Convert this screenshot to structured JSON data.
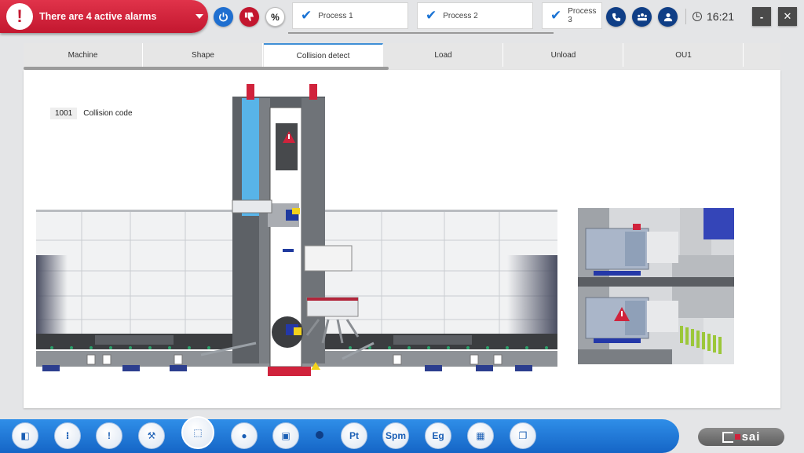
{
  "alarm": {
    "text": "There are 4 active alarms",
    "icon": "exclamation-icon",
    "color": "#d0233c"
  },
  "toolbar": {
    "power_icon": "power-icon",
    "thumb_icon": "thumbs-down-icon",
    "percent_label": "%",
    "phone_icon": "phone-icon",
    "people_icon": "team-icon",
    "user_icon": "user-icon"
  },
  "processes": [
    {
      "label": "Process 1",
      "checked": true
    },
    {
      "label": "Process 2",
      "checked": true
    },
    {
      "label": "Process 3",
      "checked": true
    }
  ],
  "clock": {
    "time": "16:21"
  },
  "window": {
    "minimize_label": "-",
    "close_label": "✕"
  },
  "tabs": [
    {
      "label": "Machine",
      "active": false
    },
    {
      "label": "Shape",
      "active": false
    },
    {
      "label": "Collision detect",
      "active": true
    },
    {
      "label": "Load",
      "active": false
    },
    {
      "label": "Unload",
      "active": false
    },
    {
      "label": "OU1",
      "active": false
    }
  ],
  "collision": {
    "code": "1001",
    "label": "Collision code"
  },
  "dock": {
    "items": [
      {
        "name": "home-dock-button",
        "icon": "split-arrow-icon",
        "glyph": "◧"
      },
      {
        "name": "modes-dock-button",
        "icon": "modes-icon",
        "glyph": "⁝"
      },
      {
        "name": "alarm-dock-button",
        "icon": "exclamation-icon",
        "glyph": "!"
      },
      {
        "name": "tools-dock-button",
        "icon": "wrench-icon",
        "glyph": "⚒"
      },
      {
        "name": "collision-dock-button",
        "icon": "frame-icon",
        "glyph": "⬚"
      },
      {
        "name": "user-dock-button",
        "icon": "user-icon",
        "glyph": "●"
      },
      {
        "name": "screen-dock-button",
        "icon": "monitor-icon",
        "glyph": "▣"
      },
      {
        "name": "pt-dock-button",
        "icon": "pt-icon",
        "label": "Pt"
      },
      {
        "name": "spm-dock-button",
        "icon": "spm-icon",
        "label": "Spm"
      },
      {
        "name": "eg-dock-button",
        "icon": "eg-icon",
        "label": "Eg"
      },
      {
        "name": "calculator-dock-button",
        "icon": "calculator-icon",
        "glyph": "▦"
      },
      {
        "name": "documents-dock-button",
        "icon": "documents-icon",
        "glyph": "❐"
      }
    ]
  },
  "brand": {
    "logo": "brand-logo",
    "text": "sai"
  }
}
